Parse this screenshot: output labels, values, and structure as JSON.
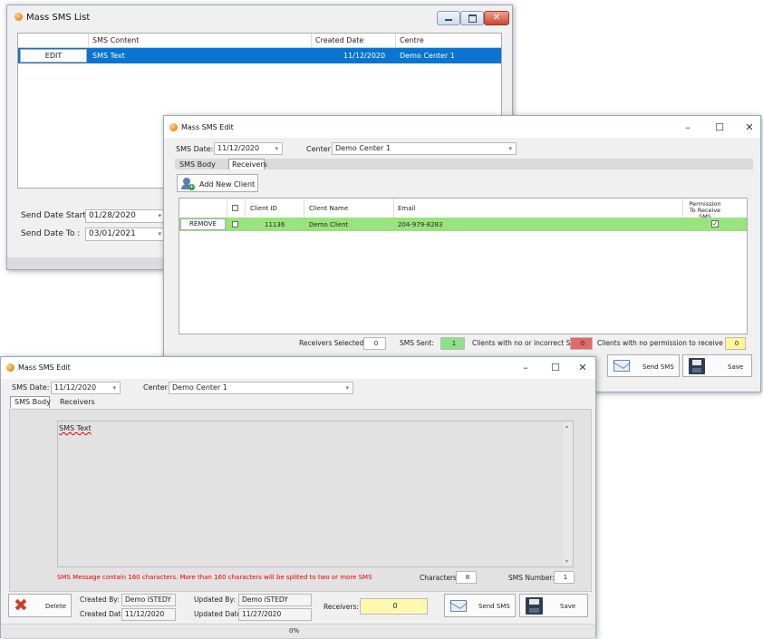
{
  "list_window": {
    "title": "Mass SMS List",
    "columns": [
      "",
      "SMS Content",
      "Created Date",
      "Centre"
    ],
    "rows": [
      {
        "action": "EDIT",
        "content": "SMS Text",
        "created": "11/12/2020",
        "centre": "Demo Center 1"
      }
    ],
    "send_date_start_label": "Send Date Start :",
    "send_date_start_value": "01/28/2020",
    "send_date_to_label": "Send Date To :",
    "send_date_to_value": "03/01/2021"
  },
  "receivers_window": {
    "title": "Mass SMS Edit",
    "sms_date_label": "SMS Date:",
    "sms_date_value": "11/12/2020",
    "center_label": "Center :",
    "center_value": "Demo Center 1",
    "tabs": [
      "SMS Body",
      "Receivers"
    ],
    "add_client_label": "Add New Client",
    "columns": {
      "client_id": "Client ID",
      "client_name": "Client Name",
      "email": "Email",
      "permission": "Permission To Receive SMS"
    },
    "rows": [
      {
        "action": "REMOVE",
        "client_id": "11136",
        "client_name": "Demo Client",
        "email": "204-979-8283",
        "permission": true
      }
    ],
    "receivers_selected_label": "Receivers Selected:",
    "receivers_selected_value": "0",
    "sms_sent_label": "SMS Sent:",
    "sms_sent_value": "1",
    "no_incorrect_label": "Clients with no or incorrect SMS:",
    "no_incorrect_value": "0",
    "no_permission_label": "Clients with no permission to receive SMS:",
    "no_permission_value": "0",
    "send_sms_label": "Send SMS",
    "save_label": "Save"
  },
  "body_window": {
    "title": "Mass SMS Edit",
    "sms_date_label": "SMS Date:",
    "sms_date_value": "11/12/2020",
    "center_label": "Center :",
    "center_value": "Demo Center 1",
    "tabs": [
      "SMS Body",
      "Receivers"
    ],
    "sms_text": "SMS Text",
    "warning": "SMS Message contain 160 characters. More than 160 characters will be splited to two or more SMS",
    "characters_label": "Characters:",
    "characters_value": "8",
    "sms_number_label": "SMS Number:",
    "sms_number_value": "1",
    "delete_label": "Delete",
    "created_by_label": "Created By:",
    "created_by_value": "Demo iSTEDY",
    "created_date_label": "Created Date:",
    "created_date_value": "11/12/2020",
    "updated_by_label": "Updated By:",
    "updated_by_value": "Demo iSTEDY",
    "updated_date_label": "Updated Date:",
    "updated_date_value": "11/27/2020",
    "receivers_label": "Receivers:",
    "receivers_value": "0",
    "send_sms_label": "Send SMS",
    "save_label": "Save",
    "progress_text": "0%"
  },
  "colors": {
    "selection": "#0a74d1",
    "green_row": "#98e37d",
    "green_badge": "#8ee08a",
    "red_badge": "#e26a6a",
    "yellow_badge": "#fff59a",
    "warning_text": "#e00000",
    "delete_icon": "#d43a2a"
  }
}
